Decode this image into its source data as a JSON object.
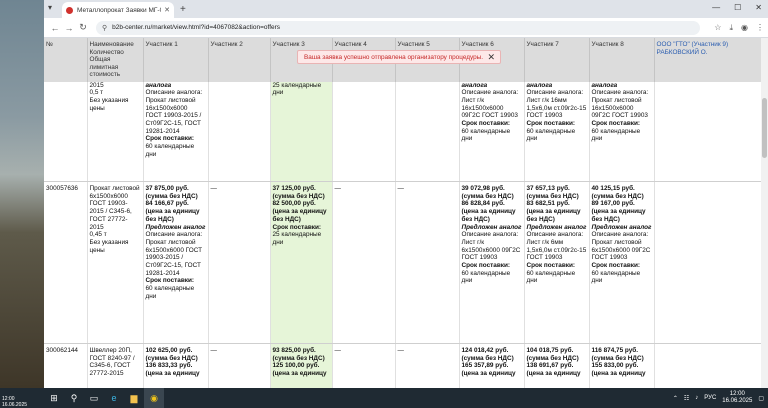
{
  "browser": {
    "tab_title": "Металлопрокат Заявки МГ-0...",
    "url": "b2b-center.ru/market/view.html?id=4067082&action=offers"
  },
  "toast": "Ваша заявка успешно отправлена организатору процедуры.",
  "table": {
    "headers": [
      "№",
      "Наименование Количество Общая лимитная стоимость",
      "Участник 1",
      "Участник 2",
      "Участник 3",
      "Участник 4",
      "Участник 5",
      "Участник 6",
      "Участник 7",
      "Участник 8",
      "ООО \"ГТО\" (Участник 9) РАБКОВСКИЙ О."
    ],
    "row0": {
      "name": "2015\n0,5 т\nБез указания цены",
      "p1": {
        "title": "аналога",
        "desc": "Описание аналога: Прокат листовой 16х1500х6000 ГОСТ 19903-2015 / Ст09Г2С-15, ГОСТ 19281-2014",
        "term_label": "Срок поставки:",
        "term": "60 календарные дни"
      },
      "p3": {
        "term": "25 календарные дни"
      },
      "p6": {
        "title": "аналога",
        "desc": "Описание аналога: Лист г/к 16х1500х6000 09Г2С ГОСТ 19903",
        "term_label": "Срок поставки:",
        "term": "60 календарные дни"
      },
      "p7": {
        "title": "аналога",
        "desc": "Описание аналога: Лист г/к 16мм 1,5х6,0м ст.09г2с-15 ГОСТ 19903",
        "term_label": "Срок поставки:",
        "term": "60 календарные дни"
      },
      "p8": {
        "title": "аналога",
        "desc": "Описание аналога: Прокат листовой 16х1500х6000 09Г2С ГОСТ 19903",
        "term_label": "Срок поставки:",
        "term": "60 календарные дни"
      }
    },
    "row1": {
      "num": "300057636",
      "name": "Прокат листовой 6х1500х6000 ГОСТ 19903-2015 / С345-6, ГОСТ 27772-2015\n0,45 т\nБез указания цены",
      "dash": "—",
      "p1": {
        "price": "37 875,00 руб.",
        "nds": "(сумма без НДС)",
        "unit": "84 166,67 руб.",
        "unit_note": "(цена за единицу без НДС)",
        "analog": "Предложен аналог",
        "desc": "Описание аналога: Прокат листовой 6х1500х6000 ГОСТ 19903-2015 / Ст09Г2С-15, ГОСТ 19281-2014",
        "term_label": "Срок поставки:",
        "term": "60 календарные дни"
      },
      "p3": {
        "price": "37 125,00 руб.",
        "nds": "(сумма без НДС)",
        "unit": "82 500,00 руб.",
        "unit_note": "(цена за единицу без НДС)",
        "term_label": "Срок поставки:",
        "term": "25 календарные дни"
      },
      "p6": {
        "price": "39 072,98 руб.",
        "nds": "(сумма без НДС)",
        "unit": "86 828,84 руб.",
        "unit_note": "(цена за единицу без НДС)",
        "analog": "Предложен аналог",
        "desc": "Описание аналога: Лист г/к 6х1500х6000 09Г2С ГОСТ 19903",
        "term_label": "Срок поставки:",
        "term": "60 календарные дни"
      },
      "p7": {
        "price": "37 657,13 руб.",
        "nds": "(сумма без НДС)",
        "unit": "83 682,51 руб.",
        "unit_note": "(цена за единицу без НДС)",
        "analog": "Предложен аналог",
        "desc": "Описание аналога: Лист г/к 6мм 1,5х6,0м ст.09г2с-15 ГОСТ 19903",
        "term_label": "Срок поставки:",
        "term": "60 календарные дни"
      },
      "p8": {
        "price": "40 125,15 руб.",
        "nds": "(сумма без НДС)",
        "unit": "89 167,00 руб.",
        "unit_note": "(цена за единицу без НДС)",
        "analog": "Предложен аналог",
        "desc": "Описание аналога: Прокат листовой 6х1500х6000 09Г2С ГОСТ 19903",
        "term_label": "Срок поставки:",
        "term": "60 календарные дни"
      }
    },
    "row2": {
      "num": "300062144",
      "name": "Швеллер 20П, ГОСТ 8240-97 / С345-6, ГОСТ 27772-2015",
      "dash": "—",
      "p1": {
        "price": "102 625,00 руб.",
        "nds": "(сумма без НДС)",
        "unit": "136 833,33 руб.",
        "unit_note": "(цена за единицу"
      },
      "p3": {
        "price": "93 825,00 руб.",
        "nds": "(сумма без НДС)",
        "unit": "125 100,00 руб.",
        "unit_note": "(цена за единицу"
      },
      "p6": {
        "price": "124 018,42 руб.",
        "nds": "(сумма без НДС)",
        "unit": "165 357,89 руб.",
        "unit_note": "(цена за единицу"
      },
      "p7": {
        "price": "104 018,75 руб.",
        "nds": "(сумма без НДС)",
        "unit": "138 691,67 руб.",
        "unit_note": "(цена за единицу"
      },
      "p8": {
        "price": "116 874,75 руб.",
        "nds": "(сумма без НДС)",
        "unit": "155 833,00 руб.",
        "unit_note": "(цена за единицу"
      }
    }
  },
  "taskbar": {
    "time": "12:00",
    "date": "16.06.2025",
    "lang": "РУС",
    "left_time": "12:00",
    "left_date": "16.06.2025"
  }
}
